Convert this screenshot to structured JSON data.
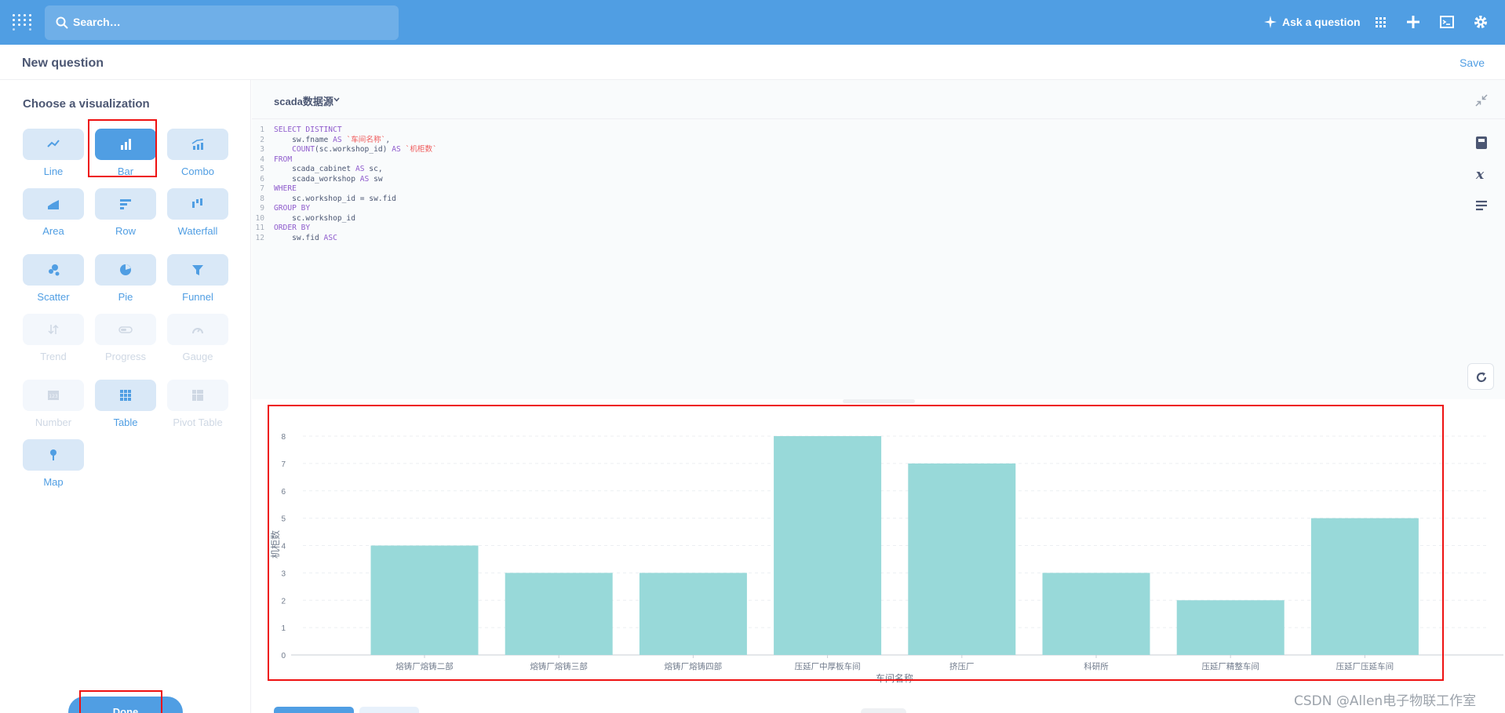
{
  "nav": {
    "search_placeholder": "Search…",
    "ask_label": "Ask a question"
  },
  "header": {
    "title": "New question",
    "save_label": "Save"
  },
  "sidebar": {
    "title": "Choose a visualization",
    "items": [
      {
        "label": "Line",
        "icon": "line-chart-icon",
        "state": "enabled"
      },
      {
        "label": "Bar",
        "icon": "bar-chart-icon",
        "state": "selected"
      },
      {
        "label": "Combo",
        "icon": "combo-chart-icon",
        "state": "enabled"
      },
      {
        "label": "Area",
        "icon": "area-chart-icon",
        "state": "enabled"
      },
      {
        "label": "Row",
        "icon": "row-chart-icon",
        "state": "enabled"
      },
      {
        "label": "Waterfall",
        "icon": "waterfall-chart-icon",
        "state": "enabled"
      },
      {
        "label": "Scatter",
        "icon": "scatter-chart-icon",
        "state": "enabled"
      },
      {
        "label": "Pie",
        "icon": "pie-chart-icon",
        "state": "enabled"
      },
      {
        "label": "Funnel",
        "icon": "funnel-chart-icon",
        "state": "enabled"
      },
      {
        "label": "Trend",
        "icon": "trend-icon",
        "state": "disabled"
      },
      {
        "label": "Progress",
        "icon": "progress-icon",
        "state": "disabled"
      },
      {
        "label": "Gauge",
        "icon": "gauge-icon",
        "state": "disabled"
      },
      {
        "label": "Number",
        "icon": "number-icon",
        "state": "disabled"
      },
      {
        "label": "Table",
        "icon": "table-icon",
        "state": "enabled"
      },
      {
        "label": "Pivot Table",
        "icon": "pivot-table-icon",
        "state": "disabled"
      },
      {
        "label": "Map",
        "icon": "map-pin-icon",
        "state": "enabled"
      }
    ],
    "done_label": "Done"
  },
  "editor": {
    "datasource": "scada数据源",
    "lines": [
      "SELECT DISTINCT",
      "    sw.fname AS `车间名称`,",
      "    COUNT(sc.workshop_id) AS `机柜数`",
      "FROM",
      "    scada_cabinet AS sc,",
      "    scada_workshop AS sw",
      "WHERE",
      "    sc.workshop_id = sw.fid",
      "GROUP BY",
      "    sc.workshop_id",
      "ORDER BY",
      "    sw.fid ASC"
    ]
  },
  "chart_data": {
    "type": "bar",
    "categories": [
      "熔铸厂熔铸二部",
      "熔铸厂熔铸三部",
      "熔铸厂熔铸四部",
      "压延厂中厚板车间",
      "挤压厂",
      "科研所",
      "压延厂精整车间",
      "压延厂压延车间"
    ],
    "values": [
      4,
      3,
      3,
      8,
      7,
      3,
      2,
      5
    ],
    "xlabel": "车间名称",
    "ylabel": "机柜数",
    "ylim": [
      0,
      8
    ],
    "yticks": [
      "0",
      "1",
      "2",
      "3",
      "4",
      "5",
      "6",
      "7",
      "8"
    ],
    "grid": true,
    "bar_color": "#98d9d9"
  },
  "watermark": "CSDN @Allen电子物联工作室"
}
